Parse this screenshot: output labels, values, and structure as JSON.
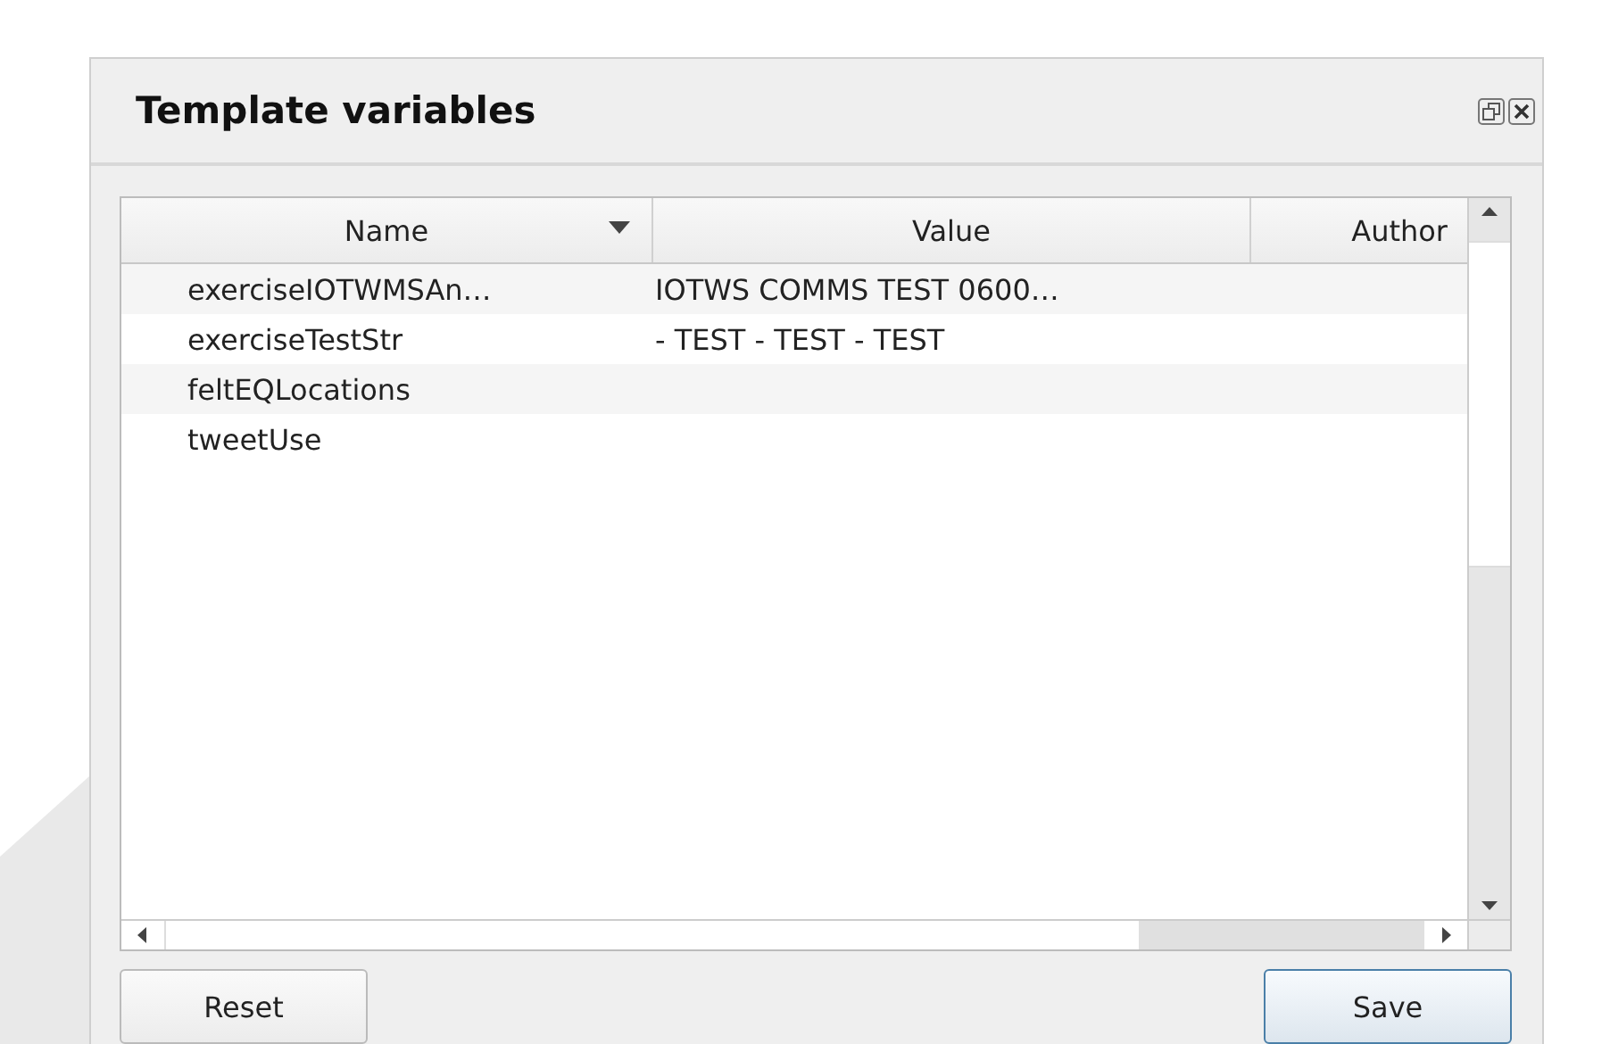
{
  "window": {
    "title": "Template variables"
  },
  "table": {
    "columns": [
      {
        "label": "Name",
        "sorted": true
      },
      {
        "label": "Value",
        "sorted": false
      },
      {
        "label": "Author",
        "sorted": false
      }
    ],
    "rows": [
      {
        "name": "exerciseIOTWMSAn…",
        "value": "IOTWS COMMS TEST 0600…"
      },
      {
        "name": "exerciseTestStr",
        "value": "- TEST - TEST - TEST"
      },
      {
        "name": "feltEQLocations",
        "value": ""
      },
      {
        "name": "tweetUse",
        "value": ""
      }
    ]
  },
  "buttons": [
    {
      "label": "Reset",
      "kind": "plain"
    },
    {
      "label": "Save",
      "kind": "default"
    }
  ]
}
